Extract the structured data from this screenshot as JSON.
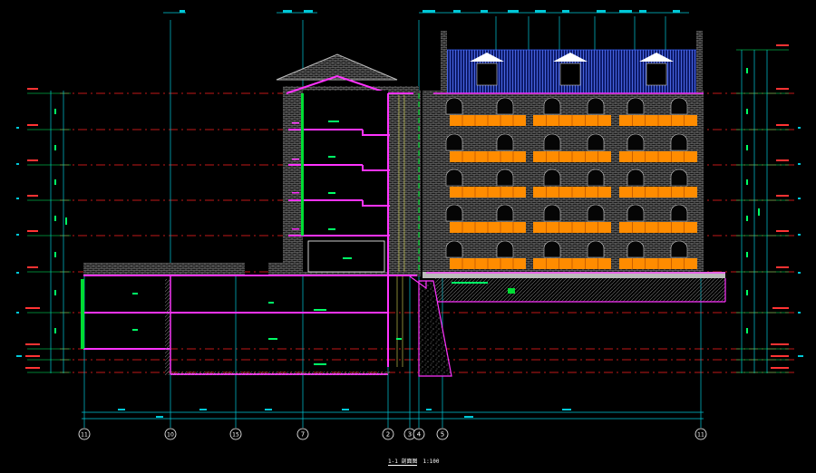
{
  "drawing": {
    "title": "1-1 剖面图",
    "scale": "1:100"
  },
  "axis_labels": [
    "11",
    "10",
    "15",
    "7",
    "2",
    "3",
    "4",
    "5",
    "11"
  ],
  "colors": {
    "background": "#000000",
    "red_level": "#ff2020",
    "magenta": "#ff33ff",
    "orange": "#ff8c00",
    "green": "#00dd33",
    "cyan": "#00c8d8",
    "gray": "#9a9a9a",
    "white": "#ffffff",
    "blue": "#2244ff"
  }
}
